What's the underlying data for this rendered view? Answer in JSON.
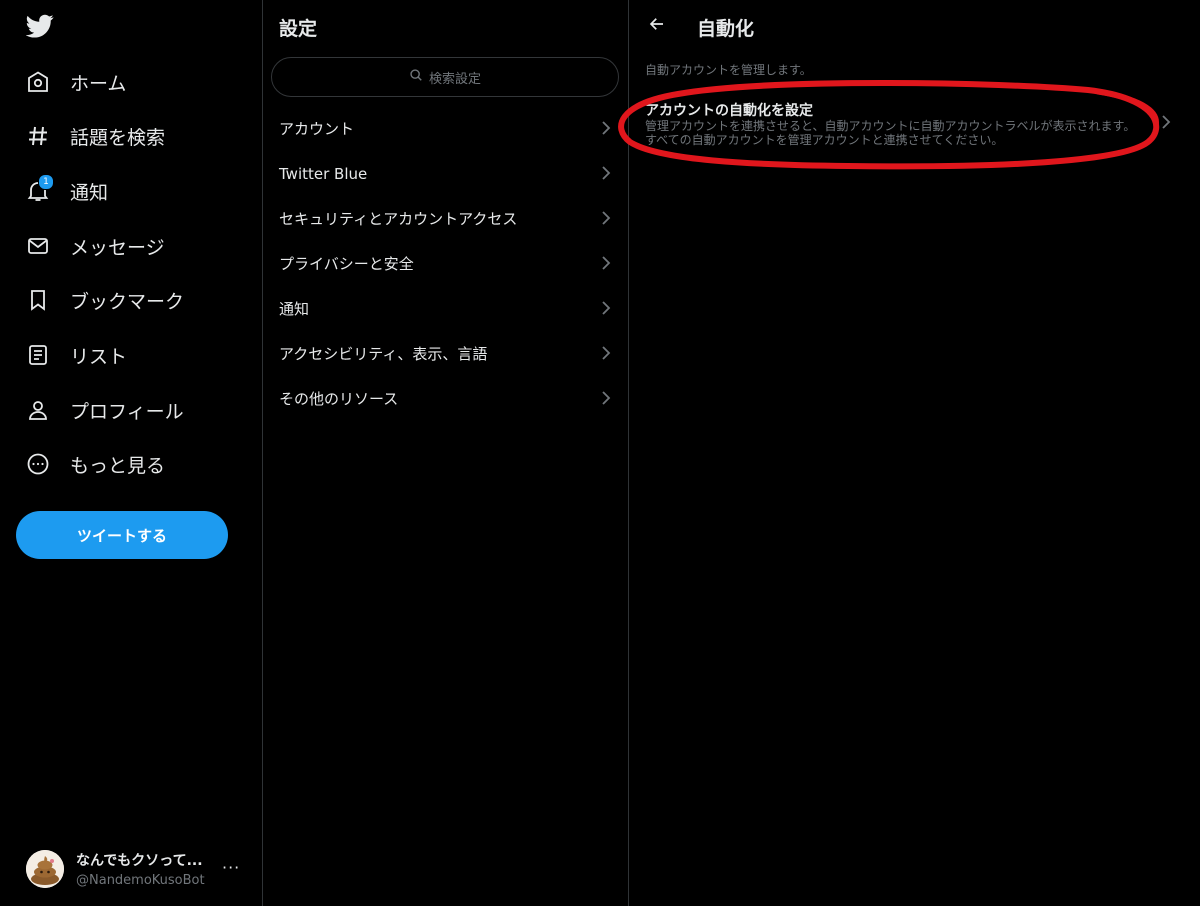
{
  "nav": {
    "items": [
      {
        "label": "ホーム",
        "icon": "home-icon"
      },
      {
        "label": "話題を検索",
        "icon": "hashtag-icon"
      },
      {
        "label": "通知",
        "icon": "bell-icon"
      },
      {
        "label": "メッセージ",
        "icon": "envelope-icon"
      },
      {
        "label": "ブックマーク",
        "icon": "bookmark-icon"
      },
      {
        "label": "リスト",
        "icon": "list-icon"
      },
      {
        "label": "プロフィール",
        "icon": "person-icon"
      },
      {
        "label": "もっと見る",
        "icon": "more-circle-icon"
      }
    ],
    "notification_count": "1",
    "tweet_button": "ツイートする"
  },
  "account": {
    "name": "なんでもクソって...",
    "handle": "@NandemoKusoBot",
    "more": "···"
  },
  "settings": {
    "title": "設定",
    "search_placeholder": "検索設定",
    "menu": [
      "アカウント",
      "Twitter Blue",
      "セキュリティとアカウントアクセス",
      "プライバシーと安全",
      "通知",
      "アクセシビリティ、表示、言語",
      "その他のリソース"
    ]
  },
  "automation": {
    "title": "自動化",
    "description": "自動アカウントを管理します。",
    "item_title": "アカウントの自動化を設定",
    "item_sub_1": "管理アカウントを連携させると、自動アカウントに自動アカウントラベルが表示されます。",
    "item_sub_2": "すべての自動アカウントを管理アカウントと連携させてください。"
  },
  "colors": {
    "background": "#000000",
    "accent": "#1d9bf0",
    "text": "#e7e9ea",
    "muted": "#71767b",
    "annotation": "#e0161c"
  }
}
